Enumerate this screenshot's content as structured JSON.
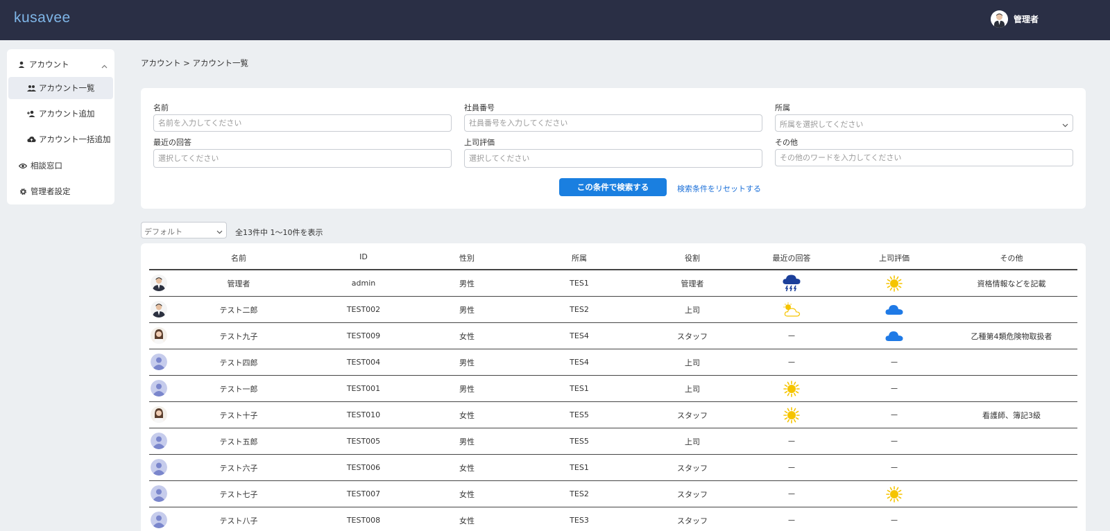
{
  "app": {
    "logo": "kusavee"
  },
  "header": {
    "user_name": "管理者"
  },
  "sidebar": {
    "section": "アカウント",
    "items": [
      {
        "label": "アカウント一覧",
        "icon": "users-icon",
        "active": true
      },
      {
        "label": "アカウント追加",
        "icon": "user-add-icon",
        "active": false
      },
      {
        "label": "アカウント一括追加",
        "icon": "cloud-upload-icon",
        "active": false
      }
    ],
    "other": [
      {
        "label": "相談窓口",
        "icon": "eye-icon"
      },
      {
        "label": "管理者設定",
        "icon": "gear-icon"
      }
    ]
  },
  "breadcrumb": "アカウント > アカウント一覧",
  "search": {
    "fields": [
      {
        "label": "名前",
        "placeholder": "名前を入力してください"
      },
      {
        "label": "社員番号",
        "placeholder": "社員番号を入力してください"
      },
      {
        "label": "所属",
        "placeholder": "所属を選択してください"
      },
      {
        "label": "最近の回答",
        "placeholder": "選択してください"
      },
      {
        "label": "上司評価",
        "placeholder": "選択してください"
      },
      {
        "label": "その他",
        "placeholder": "その他のワードを入力してください"
      }
    ],
    "submit_label": "この条件で検索する",
    "reset_label": "検索条件をリセットする"
  },
  "list": {
    "sort_value": "デフォルト",
    "count_text": "全13件中 1〜10件を表示",
    "columns": [
      "名前",
      "ID",
      "性別",
      "所属",
      "役割",
      "最近の回答",
      "上司評価",
      "その他"
    ],
    "rows": [
      {
        "avatar": "photo-man-suit",
        "name": "管理者",
        "id": "admin",
        "gender": "男性",
        "dept": "TES1",
        "role": "管理者",
        "recent": "thunderstorm",
        "boss": "sunny",
        "other": "資格情報などを記載"
      },
      {
        "avatar": "photo-man-2",
        "name": "テスト二郎",
        "id": "TEST002",
        "gender": "男性",
        "dept": "TES2",
        "role": "上司",
        "recent": "partly-sunny",
        "boss": "cloudy",
        "other": ""
      },
      {
        "avatar": "photo-woman-1",
        "name": "テスト九子",
        "id": "TEST009",
        "gender": "女性",
        "dept": "TES4",
        "role": "スタッフ",
        "recent": "none",
        "boss": "cloudy",
        "other": "乙種第4類危険物取扱者"
      },
      {
        "avatar": "default",
        "name": "テスト四郎",
        "id": "TEST004",
        "gender": "男性",
        "dept": "TES4",
        "role": "上司",
        "recent": "none",
        "boss": "none",
        "other": ""
      },
      {
        "avatar": "default",
        "name": "テスト一郎",
        "id": "TEST001",
        "gender": "男性",
        "dept": "TES1",
        "role": "上司",
        "recent": "sunny",
        "boss": "none",
        "other": ""
      },
      {
        "avatar": "photo-woman-2",
        "name": "テスト十子",
        "id": "TEST010",
        "gender": "女性",
        "dept": "TES5",
        "role": "スタッフ",
        "recent": "sunny",
        "boss": "none",
        "other": "看護師、簿記3級"
      },
      {
        "avatar": "default",
        "name": "テスト五郎",
        "id": "TEST005",
        "gender": "男性",
        "dept": "TES5",
        "role": "上司",
        "recent": "none",
        "boss": "none",
        "other": ""
      },
      {
        "avatar": "default",
        "name": "テスト六子",
        "id": "TEST006",
        "gender": "女性",
        "dept": "TES1",
        "role": "スタッフ",
        "recent": "none",
        "boss": "none",
        "other": ""
      },
      {
        "avatar": "default",
        "name": "テスト七子",
        "id": "TEST007",
        "gender": "女性",
        "dept": "TES2",
        "role": "スタッフ",
        "recent": "none",
        "boss": "sunny",
        "other": ""
      },
      {
        "avatar": "default",
        "name": "テスト八子",
        "id": "TEST008",
        "gender": "女性",
        "dept": "TES3",
        "role": "スタッフ",
        "recent": "none",
        "boss": "none",
        "other": ""
      }
    ]
  },
  "colors": {
    "header_bg": "#2a2f45",
    "logo": "#7fb6e8",
    "primary": "#1a7fe0",
    "link": "#1a6fd8",
    "sun": "#f5c400",
    "cloud": "#1f7ae6",
    "storm": "#1b3f9a"
  }
}
